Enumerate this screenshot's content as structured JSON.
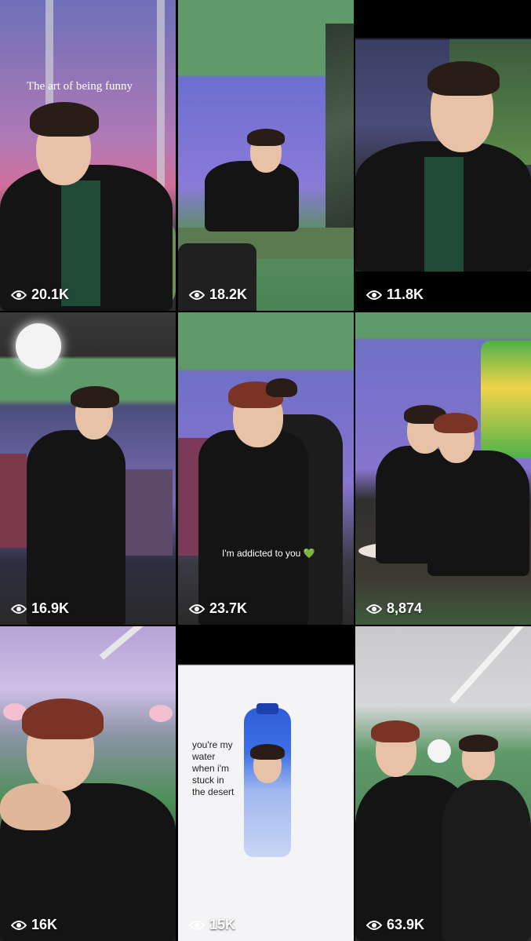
{
  "tiles": [
    {
      "views": "20.1K",
      "overlay": "The art of being funny"
    },
    {
      "views": "18.2K"
    },
    {
      "views": "11.8K"
    },
    {
      "views": "16.9K"
    },
    {
      "views": "23.7K",
      "overlay": "I'm addicted to you 💚"
    },
    {
      "views": "8,874"
    },
    {
      "views": "16K"
    },
    {
      "views": "15K",
      "overlay": "you're my water when i'm stuck in the desert"
    },
    {
      "views": "63.9K"
    }
  ],
  "icons": {
    "view_count": "eye-icon"
  },
  "colors": {
    "background": "#000000",
    "text": "#ffffff",
    "set_green": "#5e9a6a"
  }
}
